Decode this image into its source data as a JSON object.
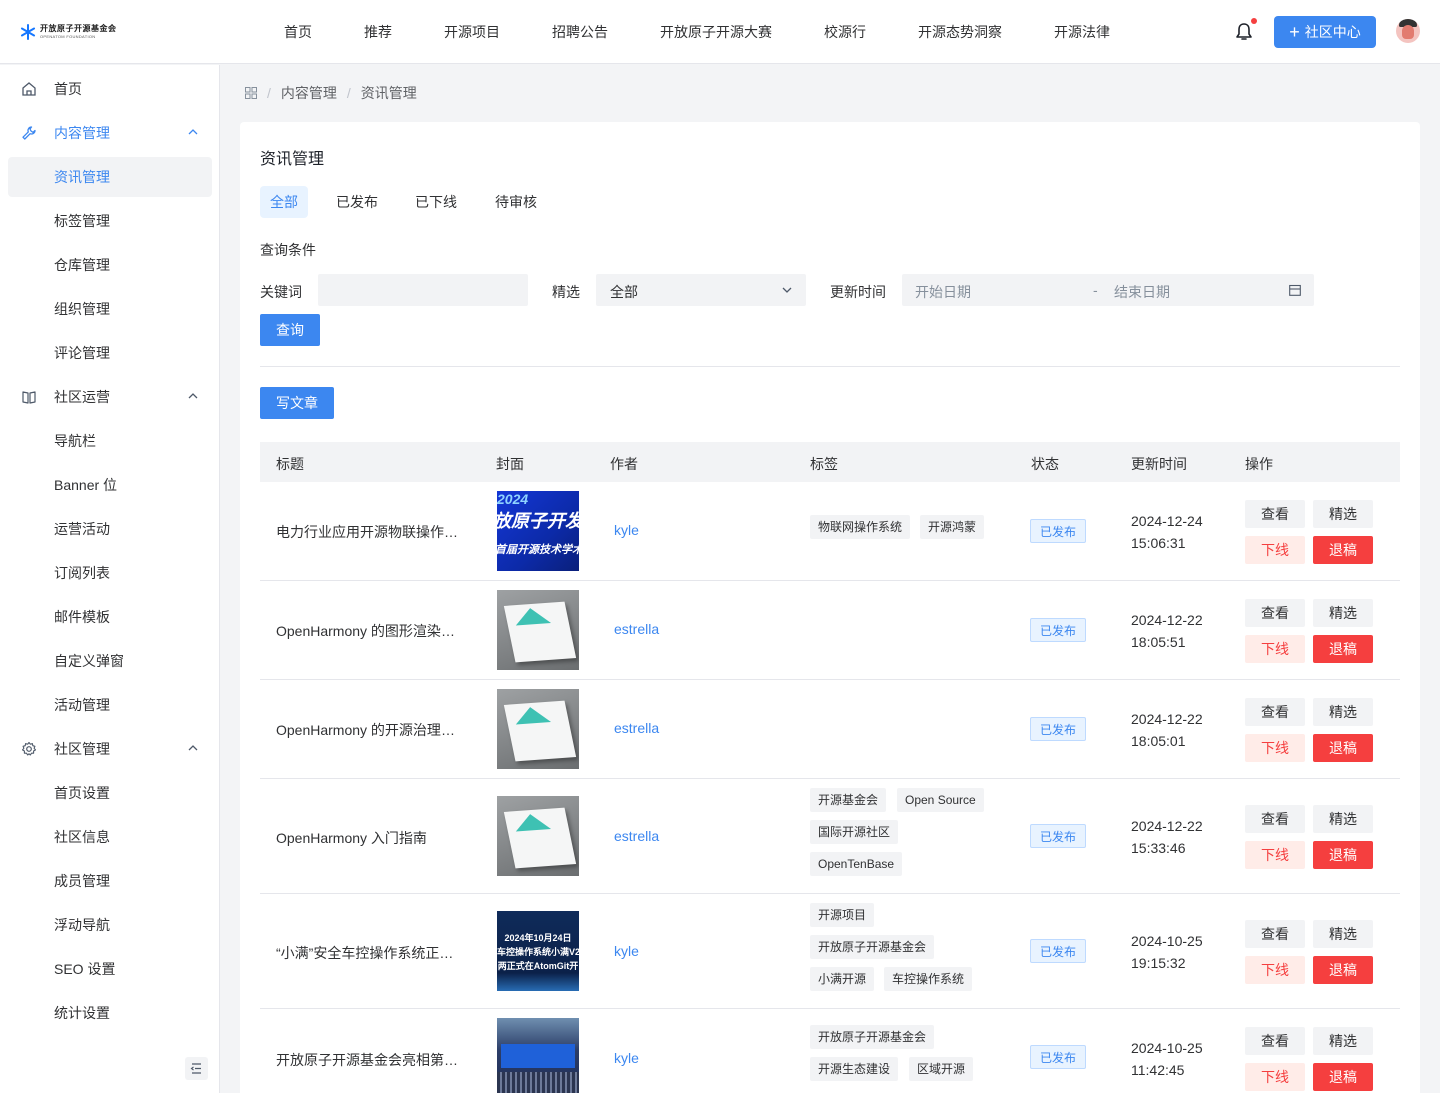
{
  "brand": {
    "name_cn": "开放原子开源基金会",
    "name_en": "OPENATOM FOUNDATION"
  },
  "topnav": [
    "首页",
    "推荐",
    "开源项目",
    "招聘公告",
    "开放原子开源大赛",
    "校源行",
    "开源态势洞察",
    "开源法律"
  ],
  "header": {
    "community_btn": "社区中心"
  },
  "sidebar": {
    "items": [
      {
        "label": "首页",
        "icon": "home-icon"
      },
      {
        "label": "内容管理",
        "icon": "wrench-icon"
      },
      {
        "label": "资讯管理"
      },
      {
        "label": "标签管理"
      },
      {
        "label": "仓库管理"
      },
      {
        "label": "组织管理"
      },
      {
        "label": "评论管理"
      },
      {
        "label": "社区运营",
        "icon": "book-icon"
      },
      {
        "label": "导航栏"
      },
      {
        "label": "Banner 位"
      },
      {
        "label": "运营活动"
      },
      {
        "label": "订阅列表"
      },
      {
        "label": "邮件模板"
      },
      {
        "label": "自定义弹窗"
      },
      {
        "label": "活动管理"
      },
      {
        "label": "社区管理",
        "icon": "gear-icon"
      },
      {
        "label": "首页设置"
      },
      {
        "label": "社区信息"
      },
      {
        "label": "成员管理"
      },
      {
        "label": "浮动导航"
      },
      {
        "label": "SEO 设置"
      },
      {
        "label": "统计设置"
      }
    ]
  },
  "breadcrumb": [
    "内容管理",
    "资讯管理"
  ],
  "page": {
    "title": "资讯管理",
    "tabs": [
      "全部",
      "已发布",
      "已下线",
      "待审核"
    ],
    "query_title": "查询条件",
    "filters": {
      "keyword_label": "关键词",
      "keyword_value": "",
      "featured_label": "精选",
      "featured_value": "全部",
      "updated_label": "更新时间",
      "start_placeholder": "开始日期",
      "range_sep": "-",
      "end_placeholder": "结束日期"
    },
    "query_btn": "查询",
    "write_btn": "写文章"
  },
  "table": {
    "headers": [
      "标题",
      "封面",
      "作者",
      "标签",
      "状态",
      "更新时间",
      "操作"
    ],
    "actions": {
      "view": "查看",
      "feature": "精选",
      "offline": "下线",
      "reject": "退稿"
    },
    "rows": [
      {
        "title": "电力行业应用开源物联操作系统…",
        "cover": "conference",
        "cover_text": [
          "2024",
          "放原子开发者大",
          "首届开源技术学术"
        ],
        "author": "kyle",
        "tags": [
          "物联网操作系统",
          "开源鸿蒙"
        ],
        "status": "已发布",
        "date": "2024-12-24",
        "time": "15:06:31"
      },
      {
        "title": "OpenHarmony 的图形渲染与合成技术",
        "cover": "book",
        "author": "estrella",
        "tags": [],
        "status": "已发布",
        "date": "2024-12-22",
        "time": "18:05:51"
      },
      {
        "title": "OpenHarmony 的开源治理与社区运营",
        "cover": "book",
        "author": "estrella",
        "tags": [],
        "status": "已发布",
        "date": "2024-12-22",
        "time": "18:05:01"
      },
      {
        "title": "OpenHarmony 入门指南",
        "cover": "book",
        "author": "estrella",
        "tags": [
          "开源基金会",
          "Open Source",
          "国际开源社区",
          "OpenTenBase"
        ],
        "status": "已发布",
        "date": "2024-12-22",
        "time": "15:33:46"
      },
      {
        "title": "“小满”安全车控操作系统正式开源",
        "cover": "auto",
        "cover_text": [
          "2024年10月24日",
          "车控操作系统小满V2",
          "两正式在AtomGit开"
        ],
        "author": "kyle",
        "tags": [
          "开源项目",
          "开放原子开源基金会",
          "小满开源",
          "车控操作系统"
        ],
        "status": "已发布",
        "date": "2024-10-25",
        "time": "19:15:32"
      },
      {
        "title": "开放原子开源基金会亮相第二届…",
        "cover": "event",
        "author": "kyle",
        "tags": [
          "开放原子开源基金会",
          "开源生态建设",
          "区域开源"
        ],
        "status": "已发布",
        "date": "2024-10-25",
        "time": "11:42:45"
      }
    ]
  }
}
